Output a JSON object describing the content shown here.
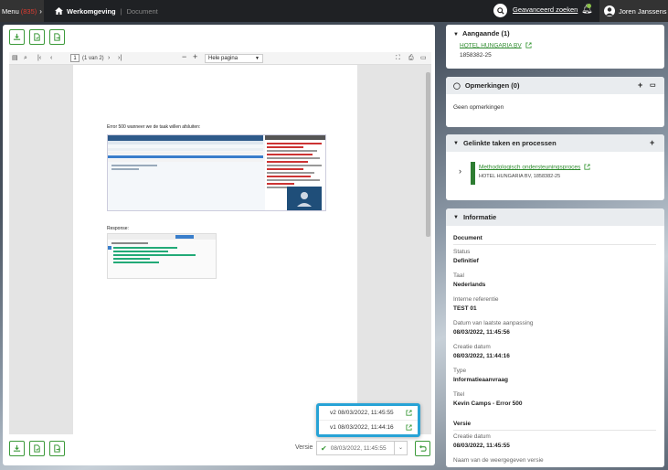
{
  "topbar": {
    "menu_label": "Menu",
    "menu_count": "(835)",
    "home_label": "Werkomgeving",
    "crumb_label": "Document",
    "advanced_search": "Geavanceerd zoeken",
    "user_name": "Joren Janssens"
  },
  "pdf": {
    "page_number": "1",
    "page_of": "(1 van 2)",
    "zoom": "Hele pagina",
    "doc_heading": "Error 500 wanneer we de taak willen afsluiten:",
    "response_label": "Response:"
  },
  "versions_dropdown": [
    {
      "version": "v2",
      "date": "08/03/2022, 11:45:55"
    },
    {
      "version": "v1",
      "date": "08/03/2022, 11:44:16"
    }
  ],
  "version_select": {
    "label": "Versie",
    "value": "08/03/2022, 11:45:55"
  },
  "aangaande": {
    "title": "Aangaande (1)",
    "link": "HOTEL HUNGARIA BV",
    "number": "1858382-25"
  },
  "opmerkingen": {
    "title": "Opmerkingen (0)",
    "empty": "Geen opmerkingen"
  },
  "gelinkte": {
    "title": "Gelinkte taken en processen",
    "item_title": "Methodologisch ondersteuningsproces",
    "item_sub": "HOTEL HUNGARIA BV, 1858382-25"
  },
  "informatie": {
    "title": "Informatie",
    "section_document": "Document",
    "fields": [
      {
        "label": "Status",
        "value": "Definitief"
      },
      {
        "label": "Taal",
        "value": "Nederlands"
      },
      {
        "label": "Interne referentie",
        "value": "TEST 01"
      },
      {
        "label": "Datum van laatste aanpassing",
        "value": "08/03/2022, 11:45:56"
      },
      {
        "label": "Creatie datum",
        "value": "08/03/2022, 11:44:16"
      },
      {
        "label": "Type",
        "value": "Informatieaanvraag"
      },
      {
        "label": "Titel",
        "value": "Kevin Camps - Error 500"
      }
    ],
    "section_versie": "Versie",
    "versie_fields": [
      {
        "label": "Creatie datum",
        "value": "08/03/2022, 11:45:55"
      },
      {
        "label": "Naam van de weergegeven versie",
        "value": ""
      }
    ]
  },
  "colors": {
    "accent_green": "#3c9a3a",
    "highlight_blue": "#27a3d6",
    "topbar": "#1f2124"
  }
}
